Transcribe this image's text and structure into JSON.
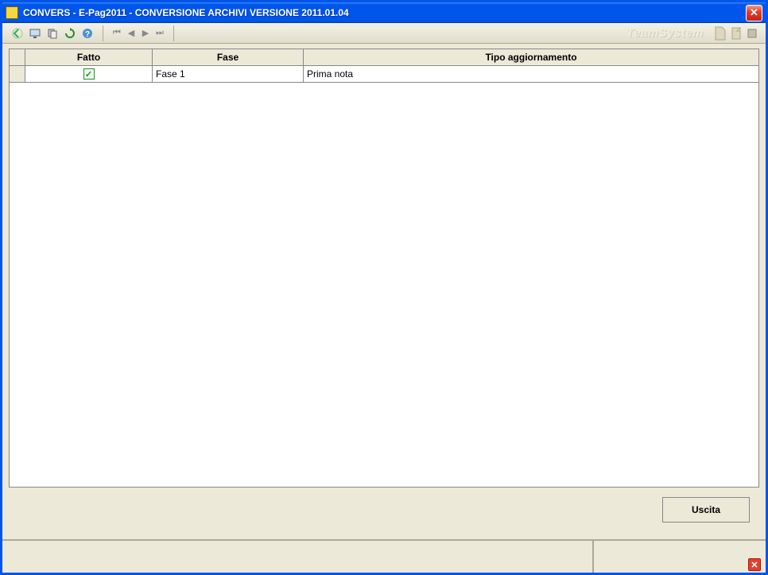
{
  "window": {
    "title": "CONVERS  - E-Pag2011  -  CONVERSIONE ARCHIVI VERSIONE 2011.01.04"
  },
  "toolbar": {
    "brand": "TeamSystem",
    "icons": {
      "back": "back-icon",
      "monitor": "monitor-icon",
      "copy": "copy-icon",
      "refresh": "refresh-icon",
      "help": "help-icon",
      "nav_first": "first-icon",
      "nav_prev": "prev-icon",
      "nav_next": "next-icon",
      "nav_last": "last-icon"
    }
  },
  "grid": {
    "headers": {
      "fatto": "Fatto",
      "fase": "Fase",
      "tipo": "Tipo aggiornamento"
    },
    "rows": [
      {
        "fatto": true,
        "fase": "Fase  1",
        "tipo": "Prima nota"
      }
    ]
  },
  "footer": {
    "exit_label": "Uscita"
  }
}
